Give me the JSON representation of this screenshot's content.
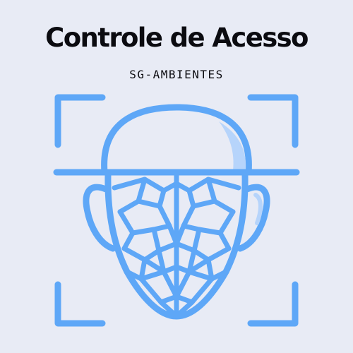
{
  "header": {
    "title": "Controle de Acesso",
    "subtitle": "SG-AMBIENTES"
  },
  "icons": {
    "face_scan": "face-scan-icon"
  },
  "colors": {
    "background": "#e8ebf5",
    "accent": "#5ea7f7",
    "accent_light": "#b6d4fb",
    "text": "#0b0b10"
  }
}
